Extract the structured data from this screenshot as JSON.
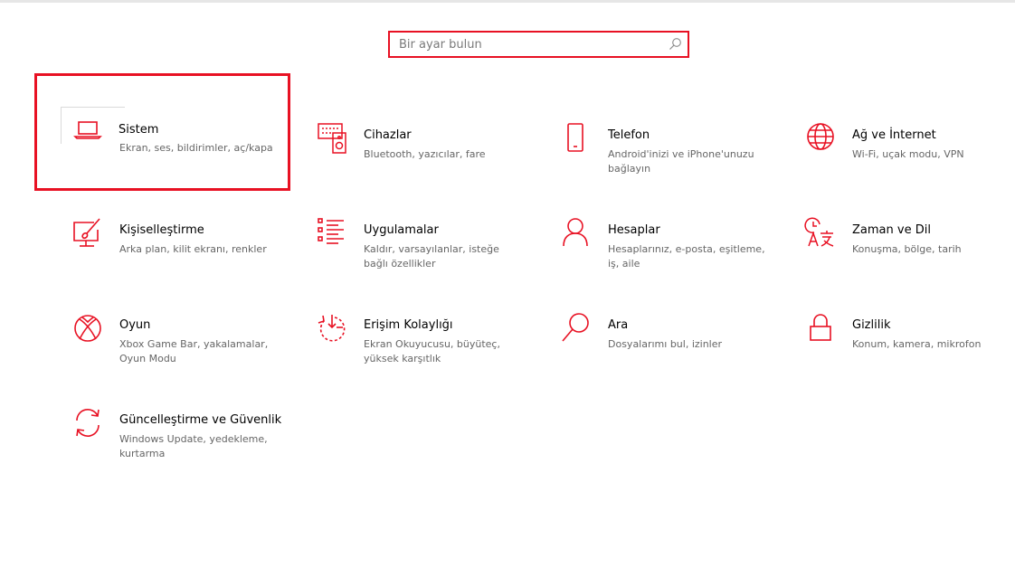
{
  "search": {
    "placeholder": "Bir ayar bulun"
  },
  "tiles": [
    {
      "title": "Sistem",
      "desc": "Ekran, ses, bildirimler, aç/kapa"
    },
    {
      "title": "Cihazlar",
      "desc": "Bluetooth, yazıcılar, fare"
    },
    {
      "title": "Telefon",
      "desc": "Android'inizi ve iPhone'unuzu bağlayın"
    },
    {
      "title": "Ağ ve İnternet",
      "desc": "Wi-Fi, uçak modu, VPN"
    },
    {
      "title": "Kişiselleştirme",
      "desc": "Arka plan, kilit ekranı, renkler"
    },
    {
      "title": "Uygulamalar",
      "desc": "Kaldır, varsayılanlar, isteğe bağlı özellikler"
    },
    {
      "title": "Hesaplar",
      "desc": "Hesaplarınız, e-posta, eşitleme, iş, aile"
    },
    {
      "title": "Zaman ve Dil",
      "desc": "Konuşma, bölge, tarih"
    },
    {
      "title": "Oyun",
      "desc": "Xbox Game Bar, yakalamalar, Oyun Modu"
    },
    {
      "title": "Erişim Kolaylığı",
      "desc": "Ekran Okuyucusu, büyüteç, yüksek karşıtlık"
    },
    {
      "title": "Ara",
      "desc": "Dosyalarımı bul, izinler"
    },
    {
      "title": "Gizlilik",
      "desc": "Konum, kamera, mikrofon"
    },
    {
      "title": "Güncelleştirme ve Güvenlik",
      "desc": "Windows Update, yedekleme, kurtarma"
    }
  ],
  "icons": {
    "tile_0": "laptop-icon",
    "tile_1": "keyboard-speaker-icon",
    "tile_2": "phone-icon",
    "tile_3": "globe-icon",
    "tile_4": "paint-brush-icon",
    "tile_5": "app-list-icon",
    "tile_6": "person-icon",
    "tile_7": "time-language-icon",
    "tile_8": "xbox-icon",
    "tile_9": "ease-of-access-icon",
    "tile_10": "search-icon",
    "tile_11": "lock-icon",
    "tile_12": "sync-icon"
  },
  "colors": {
    "accent": "#e81123",
    "title": "#000000",
    "description": "#666666"
  }
}
